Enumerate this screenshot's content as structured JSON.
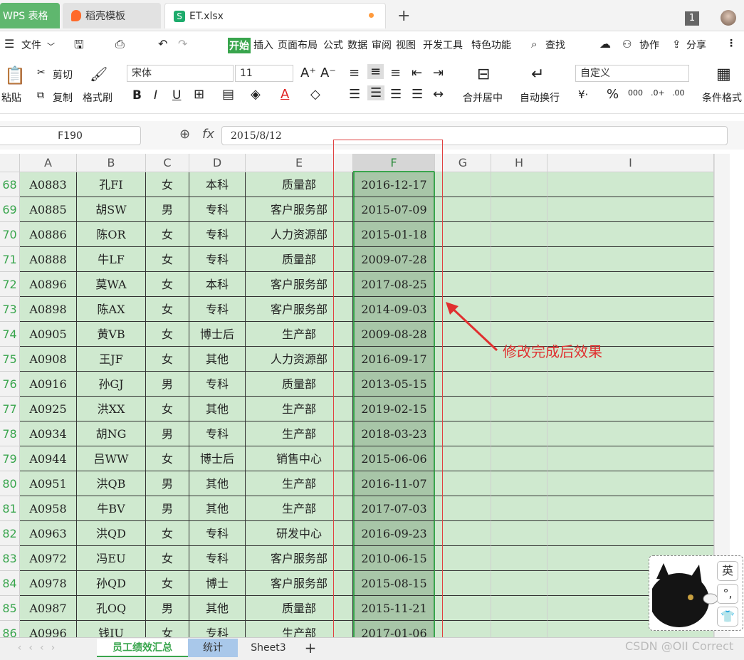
{
  "tabs": {
    "wps": "WPS 表格",
    "docer": "稻壳模板",
    "file": "ET.xlsx",
    "add": "+"
  },
  "window_count": "1",
  "menu": {
    "items": [
      "文件",
      "开始",
      "插入",
      "页面布局",
      "公式",
      "数据",
      "审阅",
      "视图",
      "开发工具",
      "特色功能",
      "查找",
      "协作",
      "分享"
    ],
    "active": "开始"
  },
  "ribbon": {
    "paste": "粘贴",
    "cut": "剪切",
    "copy": "复制",
    "format_painter": "格式刷",
    "font_name": "宋体",
    "font_size": "11",
    "merge_center": "合并居中",
    "wrap_text": "自动换行",
    "number_format": "自定义",
    "conditional_format": "条件格式"
  },
  "formula": {
    "name_box": "F190",
    "fx": "fx",
    "value": "2015/8/12"
  },
  "columns": [
    "A",
    "B",
    "C",
    "D",
    "E",
    "F",
    "G",
    "H",
    "I"
  ],
  "rows": [
    {
      "n": "68",
      "a": "A0883",
      "b": "孔FI",
      "c": "女",
      "d": "本科",
      "e": "质量部",
      "f": "2016-12-17"
    },
    {
      "n": "69",
      "a": "A0885",
      "b": "胡SW",
      "c": "男",
      "d": "专科",
      "e": "客户服务部",
      "f": "2015-07-09"
    },
    {
      "n": "70",
      "a": "A0886",
      "b": "陈OR",
      "c": "女",
      "d": "专科",
      "e": "人力资源部",
      "f": "2015-01-18"
    },
    {
      "n": "71",
      "a": "A0888",
      "b": "牛LF",
      "c": "女",
      "d": "专科",
      "e": "质量部",
      "f": "2009-07-28"
    },
    {
      "n": "72",
      "a": "A0896",
      "b": "莫WA",
      "c": "女",
      "d": "本科",
      "e": "客户服务部",
      "f": "2017-08-25"
    },
    {
      "n": "73",
      "a": "A0898",
      "b": "陈AX",
      "c": "女",
      "d": "专科",
      "e": "客户服务部",
      "f": "2014-09-03"
    },
    {
      "n": "74",
      "a": "A0905",
      "b": "黄VB",
      "c": "女",
      "d": "博士后",
      "e": "生产部",
      "f": "2009-08-28"
    },
    {
      "n": "75",
      "a": "A0908",
      "b": "王JF",
      "c": "女",
      "d": "其他",
      "e": "人力资源部",
      "f": "2016-09-17"
    },
    {
      "n": "76",
      "a": "A0916",
      "b": "孙GJ",
      "c": "男",
      "d": "专科",
      "e": "质量部",
      "f": "2013-05-15"
    },
    {
      "n": "77",
      "a": "A0925",
      "b": "洪XX",
      "c": "女",
      "d": "其他",
      "e": "生产部",
      "f": "2019-02-15"
    },
    {
      "n": "78",
      "a": "A0934",
      "b": "胡NG",
      "c": "男",
      "d": "专科",
      "e": "生产部",
      "f": "2018-03-23"
    },
    {
      "n": "79",
      "a": "A0944",
      "b": "吕WW",
      "c": "女",
      "d": "博士后",
      "e": "销售中心",
      "f": "2015-06-06"
    },
    {
      "n": "80",
      "a": "A0951",
      "b": "洪QB",
      "c": "男",
      "d": "其他",
      "e": "生产部",
      "f": "2016-11-07"
    },
    {
      "n": "81",
      "a": "A0958",
      "b": "牛BV",
      "c": "男",
      "d": "其他",
      "e": "生产部",
      "f": "2017-07-03"
    },
    {
      "n": "82",
      "a": "A0963",
      "b": "洪QD",
      "c": "女",
      "d": "专科",
      "e": "研发中心",
      "f": "2016-09-23"
    },
    {
      "n": "83",
      "a": "A0972",
      "b": "冯EU",
      "c": "女",
      "d": "专科",
      "e": "客户服务部",
      "f": "2010-06-15"
    },
    {
      "n": "84",
      "a": "A0978",
      "b": "孙QD",
      "c": "女",
      "d": "博士",
      "e": "客户服务部",
      "f": "2015-08-15"
    },
    {
      "n": "85",
      "a": "A0987",
      "b": "孔OQ",
      "c": "男",
      "d": "其他",
      "e": "质量部",
      "f": "2015-11-21"
    },
    {
      "n": "86",
      "a": "A0996",
      "b": "钱IU",
      "c": "女",
      "d": "专科",
      "e": "生产部",
      "f": "2017-01-06"
    }
  ],
  "annotation": "修改完成后效果",
  "sheets": [
    "员工绩效汇总",
    "统计",
    "Sheet3"
  ],
  "ime": {
    "lang": "英",
    "punct": "°,",
    "skin": "👕"
  },
  "watermark": "CSDN @OII Correct",
  "colors": {
    "accent": "#39a54d",
    "cell_bg": "#cfe9cf",
    "annotation": "#e03030"
  }
}
